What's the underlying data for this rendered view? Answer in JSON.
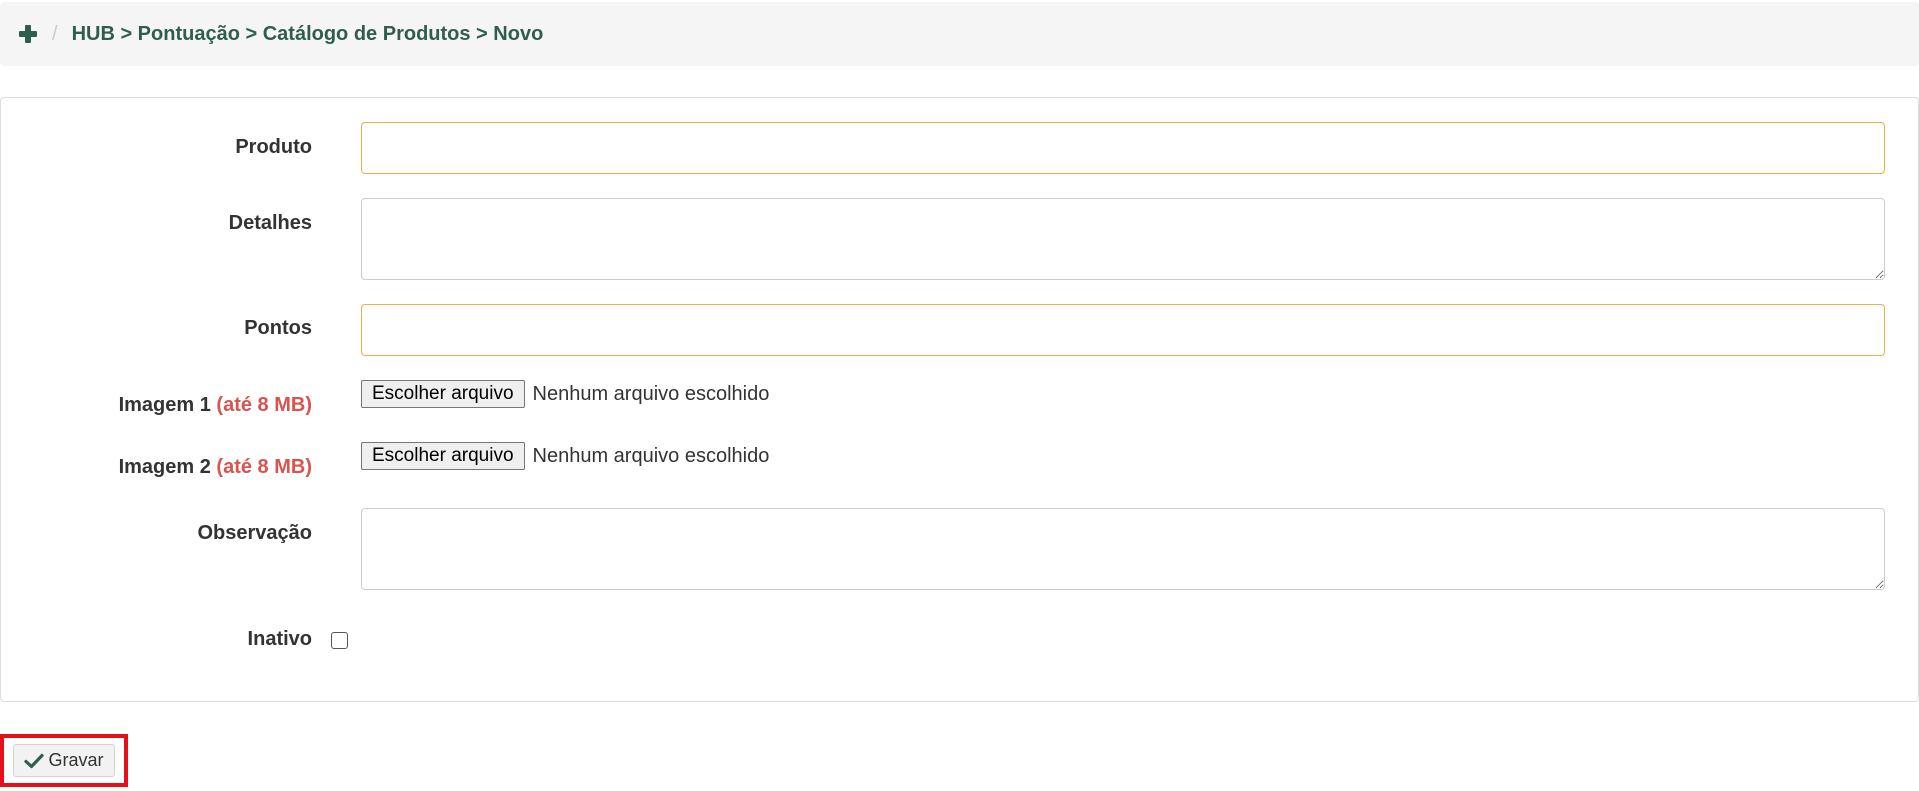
{
  "breadcrumb": {
    "icon": "plus-icon",
    "separator": "/",
    "path": "HUB > Pontuação > Catálogo de Produtos > Novo"
  },
  "form": {
    "produto": {
      "label": "Produto",
      "value": ""
    },
    "detalhes": {
      "label": "Detalhes",
      "value": ""
    },
    "pontos": {
      "label": "Pontos",
      "value": ""
    },
    "imagem1": {
      "label": "Imagem 1",
      "hint": "(até 8 MB)",
      "button_label": "Escolher arquivo",
      "status": "Nenhum arquivo escolhido"
    },
    "imagem2": {
      "label": "Imagem 2",
      "hint": "(até 8 MB)",
      "button_label": "Escolher arquivo",
      "status": "Nenhum arquivo escolhido"
    },
    "observacao": {
      "label": "Observação",
      "value": ""
    },
    "inativo": {
      "label": "Inativo",
      "checked": false
    }
  },
  "actions": {
    "save_label": "Gravar",
    "save_icon": "check-icon"
  },
  "colors": {
    "brand": "#2f5d50",
    "required_border": "#f0ad4e",
    "hint": "#d9534f",
    "highlight": "#e4101a"
  }
}
